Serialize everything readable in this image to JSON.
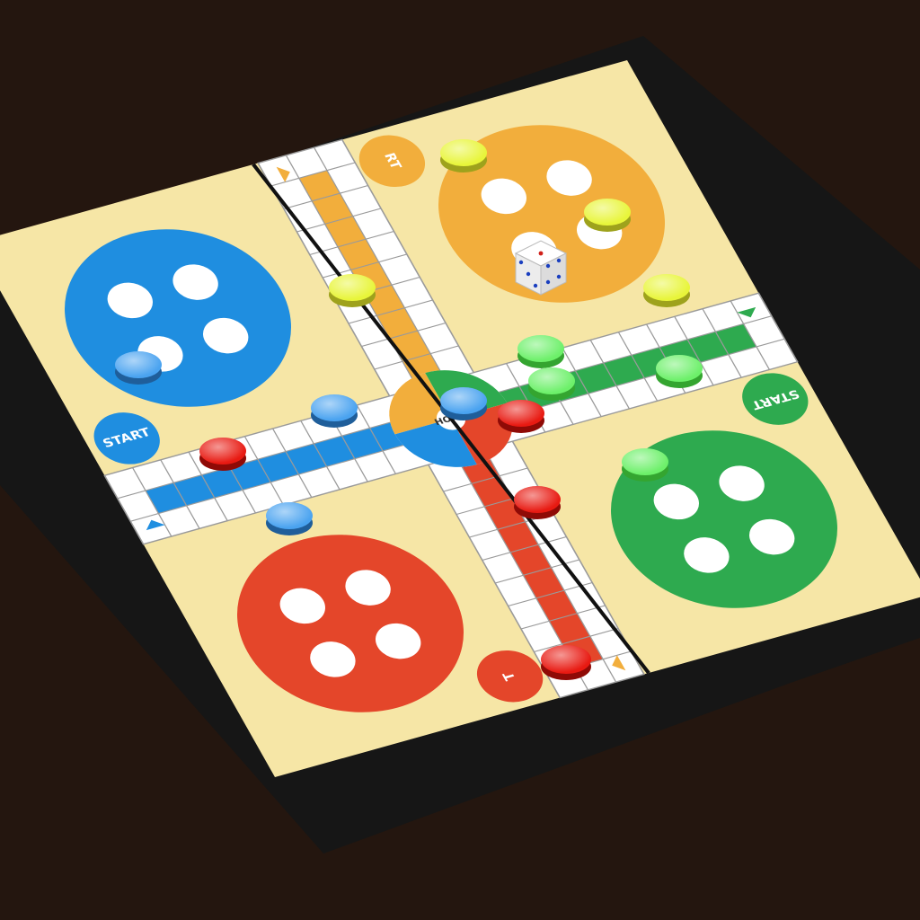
{
  "board": {
    "start_label_blue": "START",
    "start_label_green": "START",
    "start_label_yellow": "RT",
    "start_label_red": "T",
    "home_label": "HOME"
  },
  "colors": {
    "table": "#24160f",
    "frame": "#1a1a1a",
    "board": "#f6e6a6",
    "blue": "#1f8ee0",
    "yellow": "#f2ae3c",
    "green": "#2eaa4f",
    "red": "#e4462a",
    "track_cell": "#ffffff",
    "pawn_yellow": "#e8f53a",
    "pawn_green": "#6df06a",
    "pawn_red": "#e81a12",
    "pawn_blue": "#4aa3f0",
    "die": "#f4f4f4"
  },
  "pieces": {
    "yellow_count": 4,
    "green_count": 4,
    "red_count": 4,
    "blue_count": 4,
    "dice_count": 1
  }
}
